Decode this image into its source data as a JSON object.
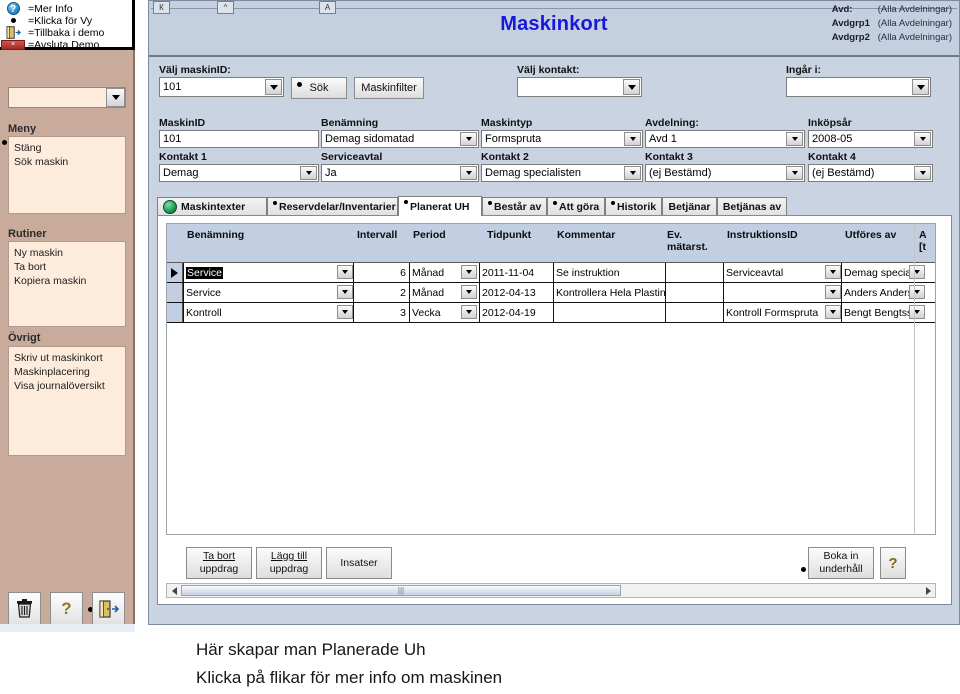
{
  "legend": {
    "items": [
      {
        "icon": "help-icon",
        "label": "=Mer Info"
      },
      {
        "icon": "bullet-icon",
        "label": "=Klicka för Vy"
      },
      {
        "icon": "door-exit-icon",
        "label": "=Tillbaka i demo"
      },
      {
        "icon": "close-window-icon",
        "label": "=Avsluta Demo"
      }
    ]
  },
  "sidebar": {
    "combo_value": "",
    "sections": [
      {
        "title": "Meny",
        "items": [
          "Stäng",
          "Sök maskin"
        ]
      },
      {
        "title": "Rutiner",
        "items": [
          "Ny maskin",
          "Ta bort",
          "Kopiera maskin"
        ]
      },
      {
        "title": "Övrigt",
        "items": [
          "Skriv ut maskinkort",
          "Maskinplacering",
          "Visa journalöversikt"
        ]
      }
    ],
    "buttons": [
      {
        "name": "trash-icon",
        "glyph": "🗑"
      },
      {
        "name": "help-icon",
        "glyph": "?"
      },
      {
        "name": "door-exit-icon",
        "glyph": "exit"
      }
    ]
  },
  "window": {
    "title": "Maskinkort",
    "ruler_tabs": [
      "К",
      "^",
      "A"
    ],
    "avd": [
      {
        "label": "Avd:",
        "value": "(Alla Avdelningar)"
      },
      {
        "label": "Avdgrp1",
        "value": "(Alla Avdelningar)"
      },
      {
        "label": "Avdgrp2",
        "value": "(Alla Avdelningar)"
      }
    ]
  },
  "search_row": {
    "maskinid_label": "Välj maskinID:",
    "maskinid_value": "101",
    "sok_button": "Sök",
    "maskinfilter_button": "Maskinfilter",
    "kontakt_label": "Välj kontakt:",
    "kontakt_value": "",
    "ingar_label": "Ingår i:",
    "ingar_value": ""
  },
  "form": {
    "fields": [
      {
        "label": "MaskinID",
        "value": "101",
        "dropdown": false
      },
      {
        "label": "Benämning",
        "value": "Demag sidomatad",
        "dropdown": true
      },
      {
        "label": "Maskintyp",
        "value": "Formspruta",
        "dropdown": true
      },
      {
        "label": "Avdelning:",
        "value": "Avd 1",
        "dropdown": true
      },
      {
        "label": "Inköpsår",
        "value": "2008-05",
        "dropdown": true
      },
      {
        "label": "Kontakt 1",
        "value": "Demag",
        "dropdown": true
      },
      {
        "label": "Serviceavtal",
        "value": "Ja",
        "dropdown": true
      },
      {
        "label": "Kontakt 2",
        "value": "Demag specialisten",
        "dropdown": true
      },
      {
        "label": "Kontakt 3",
        "value": "(ej Bestämd)",
        "dropdown": true
      },
      {
        "label": "Kontakt 4",
        "value": "(ej Bestämd)",
        "dropdown": true
      }
    ]
  },
  "tabs": [
    {
      "label": "Maskintexter",
      "icon": "globe-icon",
      "dot": false,
      "active": false
    },
    {
      "label": "Reservdelar/Inventarier",
      "icon": "",
      "dot": true,
      "active": false
    },
    {
      "label": "Planerat UH",
      "icon": "",
      "dot": true,
      "active": true
    },
    {
      "label": "Består av",
      "icon": "",
      "dot": true,
      "active": false
    },
    {
      "label": "Att göra",
      "icon": "",
      "dot": true,
      "active": false
    },
    {
      "label": "Historik",
      "icon": "",
      "dot": true,
      "active": false
    },
    {
      "label": "Betjänar",
      "icon": "",
      "dot": false,
      "active": false
    },
    {
      "label": "Betjänas av",
      "icon": "",
      "dot": false,
      "active": false
    }
  ],
  "grid": {
    "columns": [
      "Benämning",
      "Intervall",
      "Period",
      "Tidpunkt",
      "Kommentar",
      "Ev.\nmätarst.",
      "InstruktionsID",
      "Utföres av",
      "A\n[t"
    ],
    "rows": [
      {
        "selected": true,
        "benamning": "Service",
        "intervall": "6",
        "period": "Månad",
        "tidpunkt": "2011-11-04",
        "kommentar": "Se instruktion",
        "matarst": "",
        "instruktionsid": "Serviceavtal",
        "utfores_av": "Demag specialist"
      },
      {
        "selected": false,
        "benamning": "Service",
        "intervall": "2",
        "period": "Månad",
        "tidpunkt": "2012-04-13",
        "kommentar": "Kontrollera Hela Plastinma",
        "matarst": "",
        "instruktionsid": "",
        "utfores_av": "Anders Andersso"
      },
      {
        "selected": false,
        "benamning": "Kontroll",
        "intervall": "3",
        "period": "Vecka",
        "tidpunkt": "2012-04-19",
        "kommentar": "",
        "matarst": "",
        "instruktionsid": "Kontroll Formspruta",
        "utfores_av": "Bengt Bengtsson"
      }
    ],
    "buttons": {
      "ta_bort_line1": "Ta bort",
      "ta_bort_line2": "uppdrag",
      "lagg_till_line1": "Lägg till",
      "lagg_till_line2": "uppdrag",
      "insatser": "Insatser",
      "boka_line1": "Boka in",
      "boka_line2": "underhåll",
      "help": "?"
    }
  },
  "caption": {
    "line1": "Här skapar man Planerade Uh",
    "line2": "Klicka på flikar för mer info om maskinen"
  },
  "colors": {
    "title_blue": "#1818d8",
    "window_bg": "#c9d3e2",
    "sidebar_bg": "#c9ab9b",
    "sidebar_list_bg": "#fdebdb",
    "header_bg": "#c2cfe3"
  }
}
